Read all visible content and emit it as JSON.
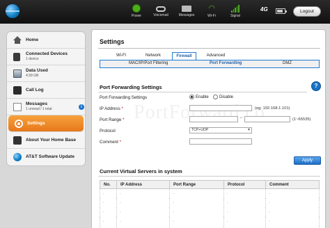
{
  "header": {
    "logo_icon": "att-globe-icon",
    "status": [
      {
        "id": "power",
        "label": "Power",
        "icon": "power-icon"
      },
      {
        "id": "voicemail",
        "label": "Voicemail",
        "icon": "voicemail-icon"
      },
      {
        "id": "messages",
        "label": "Messages",
        "icon": "envelope-icon"
      },
      {
        "id": "wifi",
        "label": "Wi-Fi",
        "icon": "wifi-icon"
      },
      {
        "id": "signal",
        "label": "Signal",
        "icon": "signal-bars-icon"
      }
    ],
    "network_type": "4G",
    "logout_label": "Logout"
  },
  "sidebar": {
    "items": [
      {
        "label": "Home",
        "sub": "",
        "icon": "home-icon"
      },
      {
        "label": "Connected Devices",
        "sub": "1 device",
        "icon": "device-icon"
      },
      {
        "label": "Data Used",
        "sub": "4.99 GB",
        "icon": "data-meter-icon"
      },
      {
        "label": "Call Log",
        "sub": "",
        "icon": "phone-icon"
      },
      {
        "label": "Messages",
        "sub": "1 unread / 1 total",
        "icon": "message-icon"
      },
      {
        "label": "Settings",
        "sub": "",
        "icon": "settings-icon"
      },
      {
        "label": "About Your Home Base",
        "sub": "",
        "icon": "home-base-icon"
      },
      {
        "label": "AT&T Software Update",
        "sub": "",
        "icon": "att-update-icon"
      }
    ],
    "active": "Settings"
  },
  "main": {
    "title": "Settings",
    "tabs": [
      "Wi-Fi",
      "Network",
      "Firewall",
      "Advanced"
    ],
    "active_tab": "Firewall",
    "subtabs": [
      "MAC/IP/Port Filtering",
      "Port Forwarding",
      "DMZ"
    ],
    "active_subtab": "Port Forwarding",
    "section_title": "Port Forwarding Settings",
    "watermark": "PortForward.co",
    "form": {
      "pfs_label": "Port Forwarding Settings",
      "enable_label": "Enable",
      "disable_label": "Disable",
      "selected": "Enable",
      "ip_label": "IP Address",
      "ip_value": "",
      "ip_hint": "(eg: 192.168.1.101)",
      "range_label": "Port Range",
      "range_start": "",
      "range_end": "",
      "range_hint": "(1~65535)",
      "protocol_label": "Protocol",
      "protocol_value": "TCP+UDP",
      "comment_label": "Comment",
      "comment_value": "",
      "required_mark": "*",
      "apply_label": "Apply"
    },
    "servers": {
      "title": "Current Virtual Servers in system",
      "columns": [
        "No.",
        "IP Address",
        "Port Range",
        "Protocol",
        "Comment"
      ],
      "rows": [
        [
          "-",
          "-",
          "-",
          "-",
          "-"
        ],
        [
          "-",
          "-",
          "-",
          "-",
          "-"
        ],
        [
          "-",
          "-",
          "-",
          "-",
          "-"
        ],
        [
          "-",
          "-",
          "-",
          "-",
          "-"
        ],
        [
          "-",
          "-",
          "-",
          "-",
          "-"
        ]
      ]
    }
  },
  "colors": {
    "accent": "#1f7ad2",
    "active_nav": "#e7781b",
    "status_green": "#4caf1a"
  }
}
